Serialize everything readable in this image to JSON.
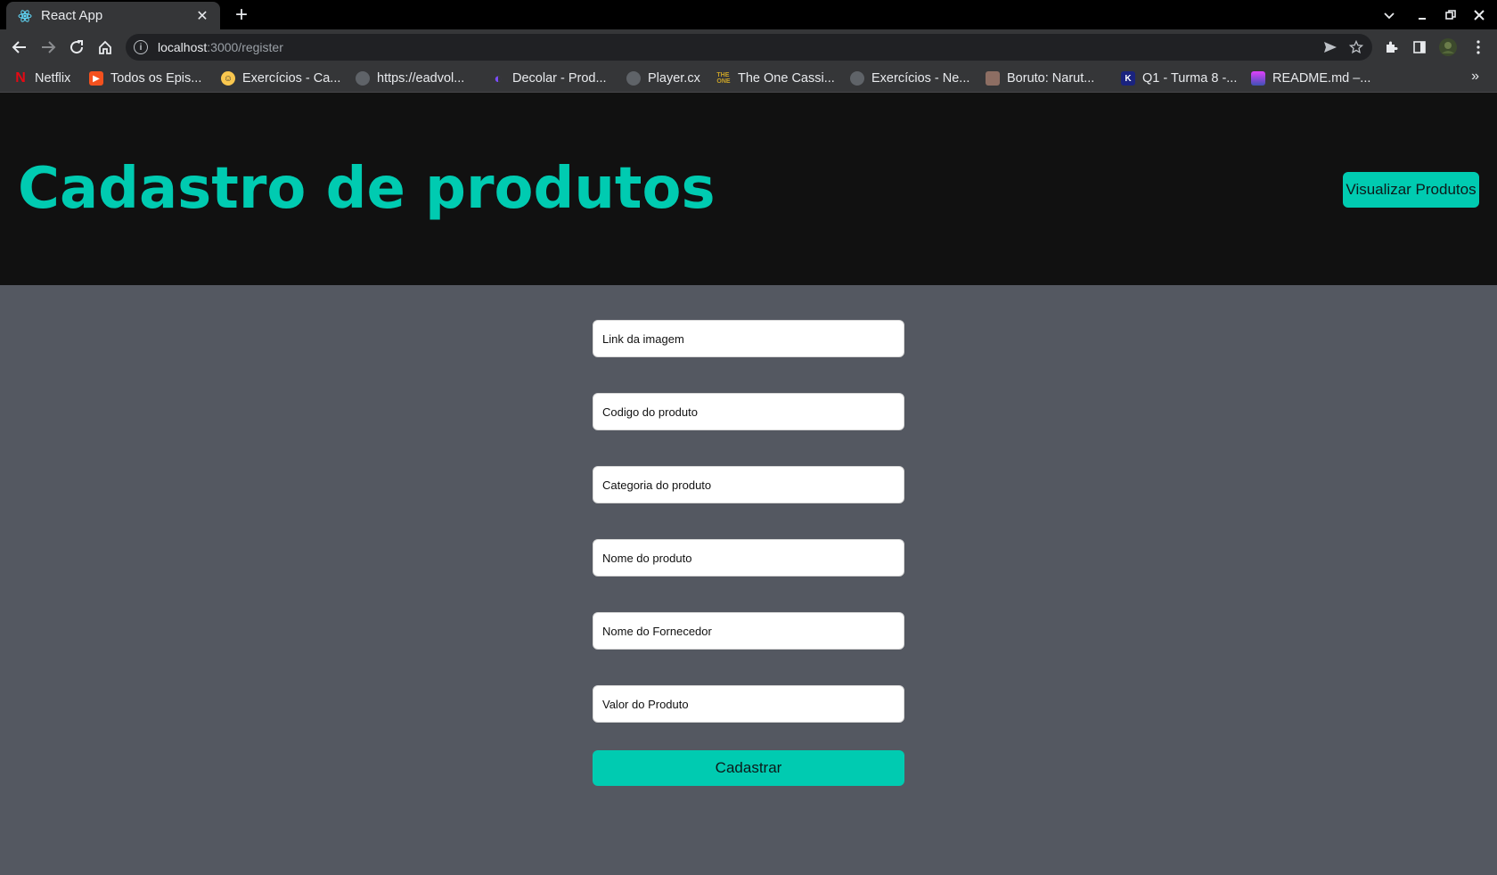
{
  "browser": {
    "tab_title": "React App",
    "url_host": "localhost",
    "url_path": ":3000/register",
    "bookmarks": [
      {
        "label": "Netflix",
        "icon": "netflix-icon",
        "color": "#e50914"
      },
      {
        "label": "Todos os Epis...",
        "icon": "play-icon",
        "color": "#f4511e"
      },
      {
        "label": "Exercícios - Ca...",
        "icon": "face-icon",
        "color": "#f9c74f"
      },
      {
        "label": "https://eadvol...",
        "icon": "globe-icon",
        "color": "#5f6368"
      },
      {
        "label": "Decolar - Prod...",
        "icon": "moon-icon",
        "color": "#7c4dff"
      },
      {
        "label": "Player.cx",
        "icon": "globe-icon",
        "color": "#5f6368"
      },
      {
        "label": "The One Cassi...",
        "icon": "the-one-icon",
        "color": "#c9a227"
      },
      {
        "label": "Exercícios - Ne...",
        "icon": "globe-icon",
        "color": "#5f6368"
      },
      {
        "label": "Boruto: Narut...",
        "icon": "boruto-icon",
        "color": "#8d6e63"
      },
      {
        "label": "Q1 - Turma 8 -...",
        "icon": "kenzie-icon",
        "color": "#1a237e"
      },
      {
        "label": "README.md –...",
        "icon": "readme-icon",
        "color": "#e040fb"
      }
    ]
  },
  "header": {
    "title": "Cadastro de produtos",
    "view_button": "Visualizar Produtos"
  },
  "form": {
    "fields": [
      {
        "placeholder": "Link da imagem"
      },
      {
        "placeholder": "Codigo do produto"
      },
      {
        "placeholder": "Categoria do produto"
      },
      {
        "placeholder": "Nome do produto"
      },
      {
        "placeholder": "Nome do Fornecedor"
      },
      {
        "placeholder": "Valor do Produto"
      }
    ],
    "submit_label": "Cadastrar"
  },
  "colors": {
    "accent": "#00cbb1",
    "header_bg": "#111111",
    "page_bg": "#545861"
  }
}
